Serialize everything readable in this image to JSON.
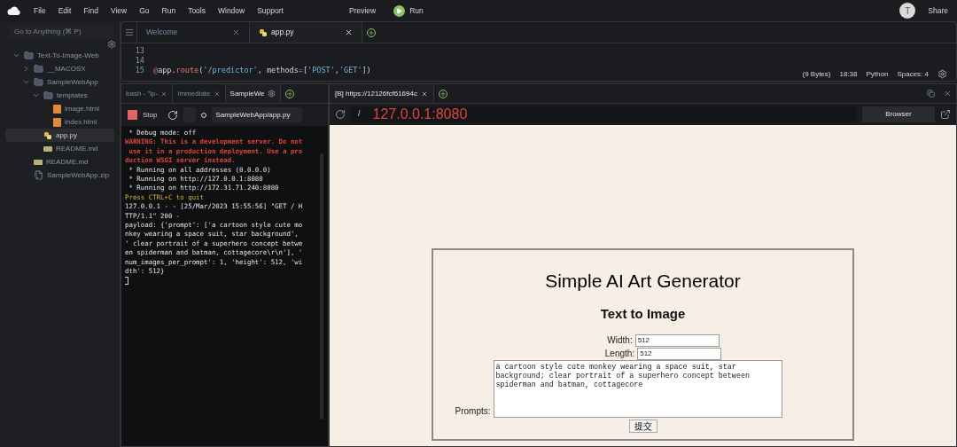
{
  "menu_bar": {
    "items": [
      "File",
      "Edit",
      "Find",
      "View",
      "Go",
      "Run",
      "Tools",
      "Window",
      "Support"
    ],
    "preview": "Preview",
    "run": "Run",
    "avatar": "T",
    "share": "Share"
  },
  "sidebar": {
    "search": {
      "placeholder": "Go to Anything (⌘ P)"
    },
    "tree": [
      {
        "label": "Text-To-Image-Web",
        "kind": "folder",
        "expanded": true,
        "selected": false,
        "children": [
          {
            "label": "__MACOSX",
            "kind": "folder",
            "expanded": false,
            "selected": false
          },
          {
            "label": "SampleWebApp",
            "kind": "folder",
            "expanded": true,
            "selected": false,
            "children": [
              {
                "label": "templates",
                "kind": "folder",
                "expanded": true,
                "selected": false,
                "children": [
                  {
                    "label": "image.html",
                    "kind": "html",
                    "selected": false
                  },
                  {
                    "label": "index.html",
                    "kind": "html",
                    "selected": false
                  }
                ]
              },
              {
                "label": "app.py",
                "kind": "python",
                "selected": true
              },
              {
                "label": "README.md",
                "kind": "markdown",
                "selected": false
              }
            ]
          },
          {
            "label": "README.md",
            "kind": "markdown",
            "selected": false
          },
          {
            "label": "SampleWebApp.zip",
            "kind": "archive",
            "selected": false
          }
        ]
      }
    ]
  },
  "editor": {
    "tabs": [
      {
        "label": "Welcome",
        "selected": false
      },
      {
        "label": "app.py",
        "selected": true
      }
    ],
    "lines": [
      {
        "number": "13"
      },
      {
        "number": "14"
      },
      {
        "number": "15",
        "segments": [
          {
            "text": "@",
            "kind": "decorator"
          },
          {
            "text": "app",
            "kind": "plain"
          },
          {
            "text": ".",
            "kind": "plain"
          },
          {
            "text": "route",
            "kind": "function"
          },
          {
            "text": "(",
            "kind": "plain"
          },
          {
            "text": "'/predictor'",
            "kind": "string"
          },
          {
            "text": ", methods",
            "kind": "plain"
          },
          {
            "text": "=",
            "kind": "operator"
          },
          {
            "text": "[",
            "kind": "plain"
          },
          {
            "text": "'POST'",
            "kind": "string"
          },
          {
            "text": ",",
            "kind": "plain"
          },
          {
            "text": "'GET'",
            "kind": "string"
          },
          {
            "text": "])",
            "kind": "plain"
          }
        ]
      }
    ],
    "status": [
      "(9 Bytes)",
      "18:38",
      "Python",
      "Spaces: 4"
    ]
  },
  "terminal": {
    "tabs": [
      {
        "label": "bash - \"ip-",
        "selected": false,
        "closable": true
      },
      {
        "label": "Immediate",
        "selected": false,
        "closable": true
      },
      {
        "label": "SampleWe",
        "selected": true,
        "closable": false
      }
    ],
    "stop": "Stop",
    "command": "SampleWebApp/app.py",
    "lines": [
      {
        "text": " * Debug mode: off",
        "kind": "normal"
      },
      {
        "text": "WARNING: This is a development server. Do not",
        "kind": "error"
      },
      {
        "text": " use it in a production deployment. Use a pro",
        "kind": "error"
      },
      {
        "text": "duction WSGI server instead.",
        "kind": "error"
      },
      {
        "text": " * Running on all addresses (0.0.0.0)",
        "kind": "normal"
      },
      {
        "text": " * Running on http://127.0.0.1:8080",
        "kind": "normal"
      },
      {
        "text": " * Running on http://172.31.71.240:8080",
        "kind": "normal"
      },
      {
        "text": "Press CTRL+C to quit",
        "kind": "notice"
      },
      {
        "text": "127.0.0.1 - - [25/Mar/2023 15:55:56] \"GET / H",
        "kind": "normal"
      },
      {
        "text": "TTP/1.1\" 200 -",
        "kind": "normal"
      },
      {
        "text": "payload: {'prompt': ['a cartoon style cute mo",
        "kind": "normal"
      },
      {
        "text": "nkey wearing a space suit, star background',",
        "kind": "normal"
      },
      {
        "text": "' clear portrait of a superhero concept betwe",
        "kind": "normal"
      },
      {
        "text": "en spiderman and batman, cottagecore\\r\\n'], '",
        "kind": "normal"
      },
      {
        "text": "num_images_per_prompt': 1, 'height': 512, 'wi",
        "kind": "normal"
      },
      {
        "text": "dth': 512}",
        "kind": "normal"
      }
    ]
  },
  "browser": {
    "tabs": [
      {
        "label": "[B] https://12126fcf61694c",
        "selected": true
      }
    ],
    "path": "/",
    "url": "127.0.0.1:8080",
    "mode": "Browser",
    "page": {
      "title": "Simple AI Art Generator",
      "subtitle": "Text to Image",
      "fields": [
        {
          "label": "Width:",
          "value": "512"
        },
        {
          "label": "Length:",
          "value": "512"
        }
      ],
      "prompts": {
        "label": "Prompts:",
        "value": "a cartoon style cute monkey wearing a space suit, star background; clear portrait of a superhero concept between spiderman and batman, cottagecore"
      },
      "submit": "提交"
    }
  }
}
